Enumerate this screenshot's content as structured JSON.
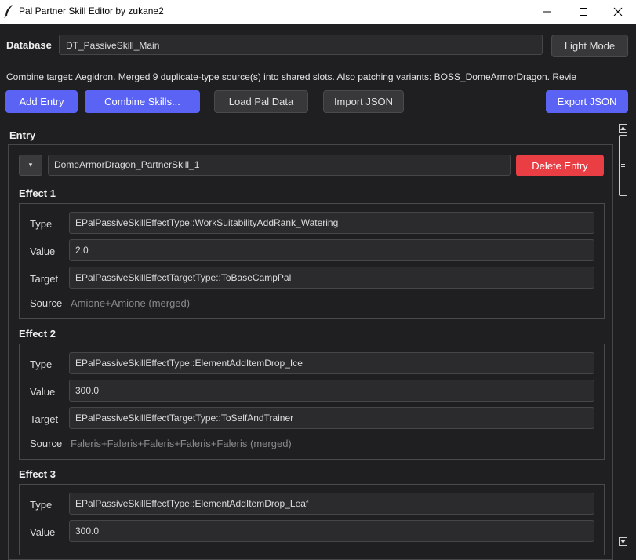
{
  "window": {
    "title": "Pal Partner Skill Editor by zukane2"
  },
  "toolbar": {
    "database_label": "Database",
    "database_value": "DT_PassiveSkill_Main",
    "light_mode_label": "Light Mode",
    "status_text": "Combine target: Aegidron. Merged 9 duplicate-type source(s) into shared slots. Also patching variants: BOSS_DomeArmorDragon. Revie",
    "add_entry_label": "Add Entry",
    "combine_skills_label": "Combine Skills...",
    "load_pal_data_label": "Load Pal Data",
    "import_json_label": "Import JSON",
    "export_json_label": "Export JSON"
  },
  "entry": {
    "heading": "Entry",
    "collapse_glyph": "▾",
    "name": "DomeArmorDragon_PartnerSkill_1",
    "delete_label": "Delete Entry"
  },
  "labels": {
    "type": "Type",
    "value": "Value",
    "target": "Target",
    "source": "Source"
  },
  "effects": [
    {
      "heading": "Effect 1",
      "type": "EPalPassiveSkillEffectType::WorkSuitabilityAddRank_Watering",
      "value": "2.0",
      "target": "EPalPassiveSkillEffectTargetType::ToBaseCampPal",
      "source": "Amione+Amione (merged)"
    },
    {
      "heading": "Effect 2",
      "type": "EPalPassiveSkillEffectType::ElementAddItemDrop_Ice",
      "value": "300.0",
      "target": "EPalPassiveSkillEffectTargetType::ToSelfAndTrainer",
      "source": "Faleris+Faleris+Faleris+Faleris+Faleris (merged)"
    },
    {
      "heading": "Effect 3",
      "type": "EPalPassiveSkillEffectType::ElementAddItemDrop_Leaf",
      "value": "300.0"
    }
  ],
  "colors": {
    "accent_blue": "#5a63f4",
    "danger_red": "#ea3e45",
    "background": "#1f1f21"
  }
}
